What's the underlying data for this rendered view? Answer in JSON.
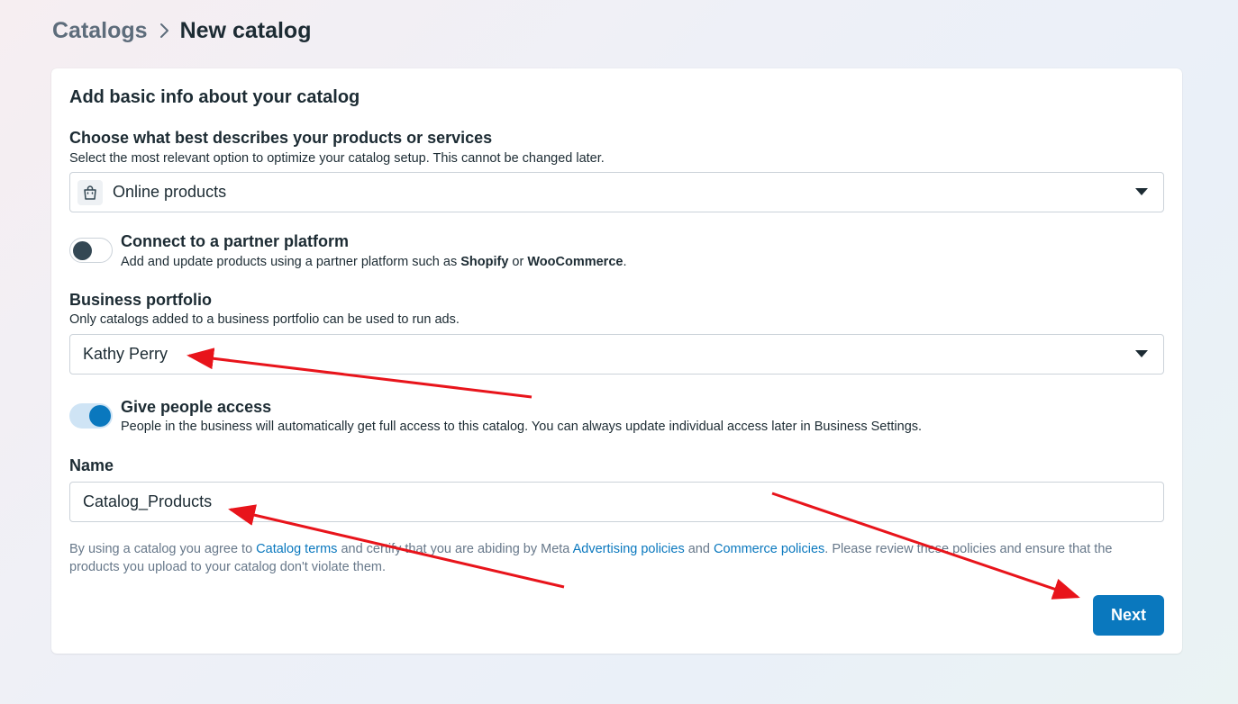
{
  "breadcrumb": {
    "root": "Catalogs",
    "current": "New catalog"
  },
  "card": {
    "title": "Add basic info about your catalog",
    "product_type": {
      "label": "Choose what best describes your products or services",
      "help": "Select the most relevant option to optimize your catalog setup. This cannot be changed later.",
      "selected": "Online products",
      "icon": "shopping-bag-icon"
    },
    "partner_platform": {
      "title": "Connect to a partner platform",
      "help_prefix": "Add and update products using a partner platform such as ",
      "shopify": "Shopify",
      "or": " or ",
      "woocommerce": "WooCommerce",
      "help_suffix": ".",
      "enabled": false
    },
    "business_portfolio": {
      "label": "Business portfolio",
      "help": "Only catalogs added to a business portfolio can be used to run ads.",
      "selected": "Kathy Perry"
    },
    "people_access": {
      "title": "Give people access",
      "help": "People in the business will automatically get full access to this catalog. You can always update individual access later in Business Settings.",
      "enabled": true
    },
    "name": {
      "label": "Name",
      "value": "Catalog_Products"
    },
    "legal": {
      "t1": "By using a catalog you agree to ",
      "link1": "Catalog terms",
      "t2": " and certify that you are abiding by Meta ",
      "link2": "Advertising policies",
      "t3": " and ",
      "link3": "Commerce policies",
      "t4": ". Please review these policies and ensure that the products you upload to your catalog don't violate them."
    },
    "next_label": "Next"
  },
  "colors": {
    "accent": "#0a78be",
    "annotation_arrow": "#e8141b",
    "text_primary": "#1c2b33",
    "text_secondary": "#67788a"
  }
}
